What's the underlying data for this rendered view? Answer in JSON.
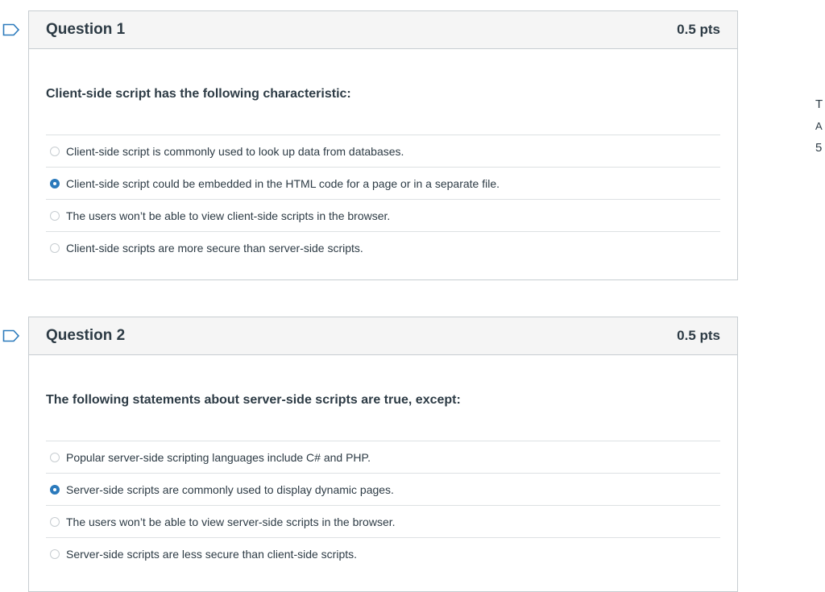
{
  "questions": [
    {
      "title": "Question 1",
      "points": "0.5 pts",
      "text": "Client-side script has the following characteristic:",
      "answers": [
        {
          "label": "Client-side script is commonly used to look up data from databases.",
          "selected": false
        },
        {
          "label": "Client-side script could be embedded in the HTML code for a page or in a separate file.",
          "selected": true
        },
        {
          "label": "The users won’t be able to view client-side scripts in the browser.",
          "selected": false
        },
        {
          "label": "Client-side scripts are more secure than server-side scripts.",
          "selected": false
        }
      ]
    },
    {
      "title": "Question 2",
      "points": "0.5 pts",
      "text": "The following statements about server-side scripts are true, except:",
      "answers": [
        {
          "label": "Popular server-side scripting languages include C# and PHP.",
          "selected": false
        },
        {
          "label": "Server-side scripts are commonly used to display dynamic pages.",
          "selected": true
        },
        {
          "label": "The users won’t be able to view server-side scripts in the browser.",
          "selected": false
        },
        {
          "label": "Server-side scripts are less secure than client-side scripts.",
          "selected": false
        }
      ]
    }
  ],
  "side_panel": {
    "line1": "T",
    "line2": "A",
    "line3": "5"
  },
  "colors": {
    "accent": "#2b7abc",
    "border": "#c7cdd1",
    "header_bg": "#f5f5f5",
    "text": "#2d3b45"
  },
  "icons": {
    "flag": "flag-question-icon",
    "radio_selected": "radio-selected-icon",
    "radio_unselected": "radio-unselected-icon"
  }
}
